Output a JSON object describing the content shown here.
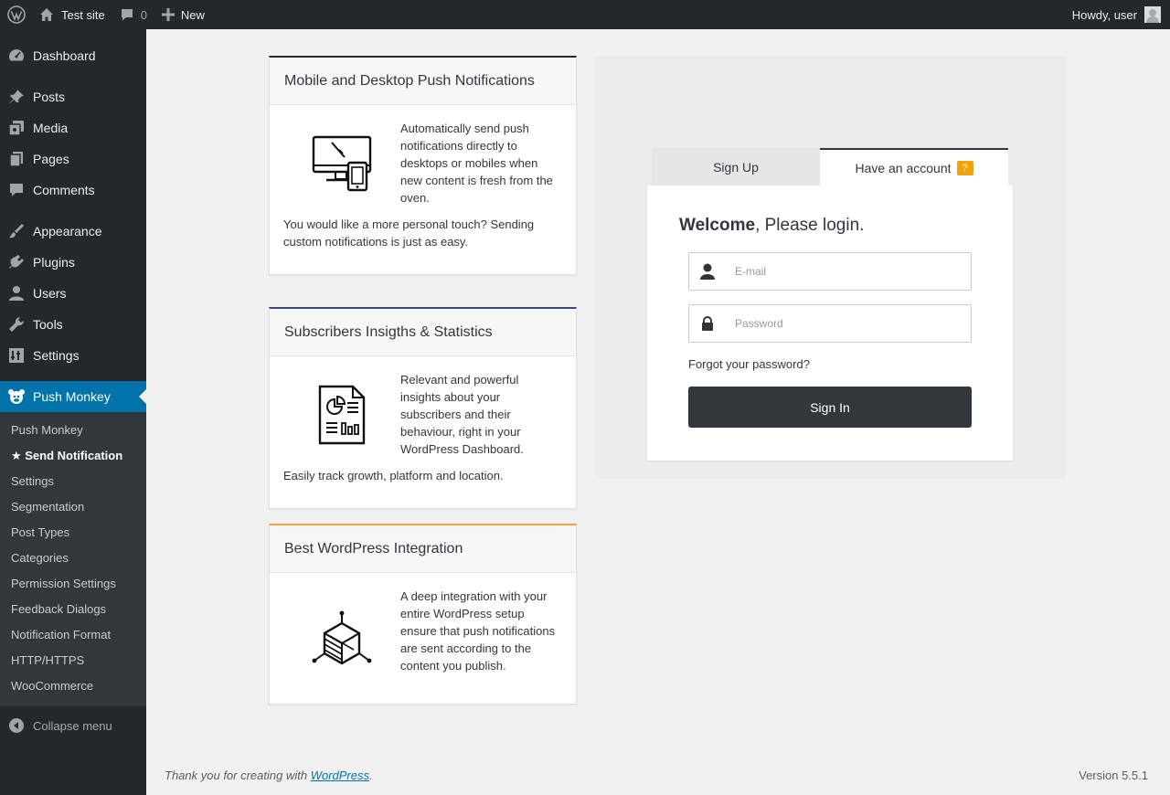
{
  "adminbar": {
    "site_name": "Test site",
    "comments_count": "0",
    "new_label": "New",
    "greeting": "Howdy, user"
  },
  "sidebar": {
    "items": [
      {
        "label": "Dashboard",
        "icon": "dashboard-icon"
      },
      {
        "label": "Posts",
        "icon": "pin-icon"
      },
      {
        "label": "Media",
        "icon": "media-icon"
      },
      {
        "label": "Pages",
        "icon": "pages-icon"
      },
      {
        "label": "Comments",
        "icon": "comment-icon"
      },
      {
        "label": "Appearance",
        "icon": "brush-icon"
      },
      {
        "label": "Plugins",
        "icon": "plugin-icon"
      },
      {
        "label": "Users",
        "icon": "user-icon"
      },
      {
        "label": "Tools",
        "icon": "wrench-icon"
      },
      {
        "label": "Settings",
        "icon": "settings-icon"
      },
      {
        "label": "Push Monkey",
        "icon": "monkey-icon"
      }
    ],
    "submenu": [
      "Push Monkey",
      "★ Send Notification",
      "Settings",
      "Segmentation",
      "Post Types",
      "Categories",
      "Permission Settings",
      "Feedback Dialogs",
      "Notification Format",
      "HTTP/HTTPS",
      "WooCommerce"
    ],
    "collapse_label": "Collapse menu"
  },
  "cards": [
    {
      "title": "Mobile and Desktop Push Notifications",
      "accent": "#23282d",
      "p1": "Automatically send push notifications directly to desktops or mobiles when new content is fresh from the oven.",
      "p2": "You would like a more personal touch? Sending custom notifications is just as easy."
    },
    {
      "title": "Subscribers Insigths & Statistics",
      "accent": "#3b4a7a",
      "p1": "Relevant and powerful insights about your subscribers and their behaviour, right in your WordPress Dashboard.",
      "p2": "Easily track growth, platform and location."
    },
    {
      "title": "Best WordPress Integration",
      "accent": "#f6a23a",
      "p1": "A deep integration with your entire WordPress setup ensure that push notifications are sent according to the content you publish."
    }
  ],
  "login": {
    "tab_signup": "Sign Up",
    "tab_login": "Have an account",
    "tab_badge": "?",
    "welcome_bold": "Welcome",
    "welcome_rest": ", Please login.",
    "email_placeholder": "E-mail",
    "password_placeholder": "Password",
    "forgot": "Forgot your password?",
    "signin": "Sign In"
  },
  "footer": {
    "thanks_prefix": "Thank you for creating with ",
    "wp_link": "WordPress",
    "thanks_suffix": ".",
    "version": "Version 5.5.1"
  }
}
